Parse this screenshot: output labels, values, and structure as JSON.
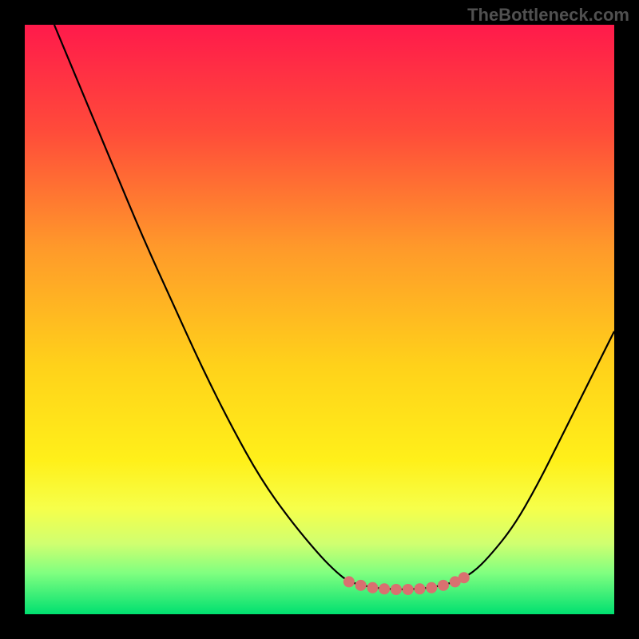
{
  "watermark": "TheBottleneck.com",
  "chart_data": {
    "type": "line",
    "title": "",
    "xlabel": "",
    "ylabel": "",
    "xlim": [
      0,
      100
    ],
    "ylim": [
      0,
      100
    ],
    "gradient_stops": [
      {
        "offset": 0,
        "color": "#ff1a4b"
      },
      {
        "offset": 18,
        "color": "#ff4b3a"
      },
      {
        "offset": 38,
        "color": "#ff9a2a"
      },
      {
        "offset": 58,
        "color": "#ffd21a"
      },
      {
        "offset": 74,
        "color": "#fff01a"
      },
      {
        "offset": 82,
        "color": "#f6ff4a"
      },
      {
        "offset": 88,
        "color": "#d0ff70"
      },
      {
        "offset": 93,
        "color": "#80ff80"
      },
      {
        "offset": 100,
        "color": "#00e070"
      }
    ],
    "series": [
      {
        "name": "curve",
        "color": "#000000",
        "points": [
          {
            "x": 5,
            "y": 100
          },
          {
            "x": 10,
            "y": 88
          },
          {
            "x": 15,
            "y": 76
          },
          {
            "x": 20,
            "y": 64
          },
          {
            "x": 25,
            "y": 53
          },
          {
            "x": 30,
            "y": 42
          },
          {
            "x": 35,
            "y": 32
          },
          {
            "x": 40,
            "y": 23
          },
          {
            "x": 45,
            "y": 16
          },
          {
            "x": 50,
            "y": 10
          },
          {
            "x": 53,
            "y": 7
          },
          {
            "x": 55,
            "y": 5.5
          },
          {
            "x": 58,
            "y": 4.7
          },
          {
            "x": 61,
            "y": 4.3
          },
          {
            "x": 64,
            "y": 4.2
          },
          {
            "x": 67,
            "y": 4.3
          },
          {
            "x": 70,
            "y": 4.7
          },
          {
            "x": 73,
            "y": 5.5
          },
          {
            "x": 76,
            "y": 7
          },
          {
            "x": 79,
            "y": 10
          },
          {
            "x": 83,
            "y": 15
          },
          {
            "x": 87,
            "y": 22
          },
          {
            "x": 91,
            "y": 30
          },
          {
            "x": 95,
            "y": 38
          },
          {
            "x": 100,
            "y": 48
          }
        ]
      }
    ],
    "markers": {
      "color": "#d97070",
      "radius": 7,
      "points": [
        {
          "x": 55,
          "y": 5.5
        },
        {
          "x": 57,
          "y": 4.9
        },
        {
          "x": 59,
          "y": 4.5
        },
        {
          "x": 61,
          "y": 4.3
        },
        {
          "x": 63,
          "y": 4.2
        },
        {
          "x": 65,
          "y": 4.2
        },
        {
          "x": 67,
          "y": 4.3
        },
        {
          "x": 69,
          "y": 4.5
        },
        {
          "x": 71,
          "y": 4.9
        },
        {
          "x": 73,
          "y": 5.5
        },
        {
          "x": 74.5,
          "y": 6.2
        }
      ]
    }
  }
}
